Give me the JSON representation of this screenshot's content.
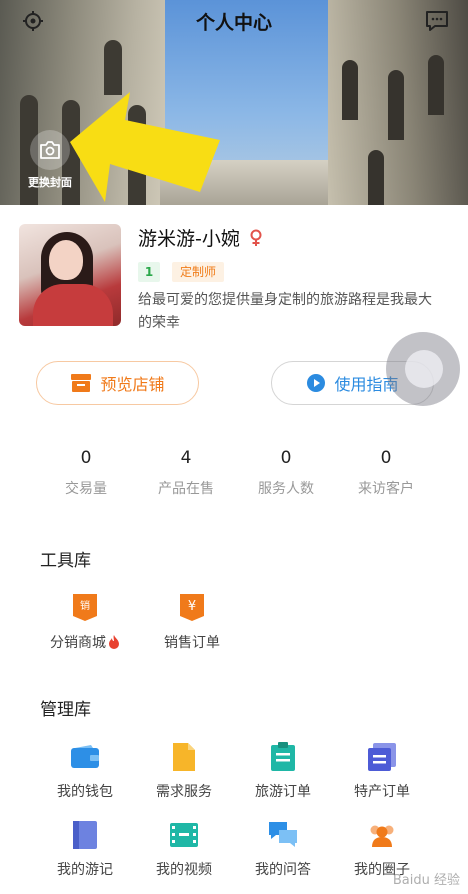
{
  "header": {
    "title": "个人中心",
    "cover_button_label": "更换封面"
  },
  "profile": {
    "name": "游米游-小婉",
    "level": "1",
    "role": "定制师",
    "bio": "给最可爱的您提供量身定制的旅游路程是我最大的荣幸"
  },
  "actions": {
    "shop_label": "预览店铺",
    "guide_label": "使用指南"
  },
  "stats": [
    {
      "value": "0",
      "label": "交易量"
    },
    {
      "value": "4",
      "label": "产品在售"
    },
    {
      "value": "0",
      "label": "服务人数"
    },
    {
      "value": "0",
      "label": "来访客户"
    }
  ],
  "tools": {
    "title": "工具库",
    "items": [
      {
        "label": "分销商城",
        "icon": "distribution-mall-icon"
      },
      {
        "label": "销售订单",
        "icon": "sales-order-icon"
      }
    ]
  },
  "management": {
    "title": "管理库",
    "items": [
      {
        "label": "我的钱包",
        "icon": "wallet-icon"
      },
      {
        "label": "需求服务",
        "icon": "demand-service-icon"
      },
      {
        "label": "旅游订单",
        "icon": "travel-order-icon"
      },
      {
        "label": "特产订单",
        "icon": "specialty-order-icon"
      },
      {
        "label": "我的游记",
        "icon": "travel-notes-icon"
      },
      {
        "label": "我的视频",
        "icon": "video-icon"
      },
      {
        "label": "我的问答",
        "icon": "qa-icon"
      },
      {
        "label": "我的圈子",
        "icon": "circle-icon"
      }
    ]
  },
  "colors": {
    "accent_orange": "#f07a1a",
    "accent_blue": "#2b8be0",
    "level_green": "#2aa84a"
  },
  "watermark": "Baidu 经验"
}
